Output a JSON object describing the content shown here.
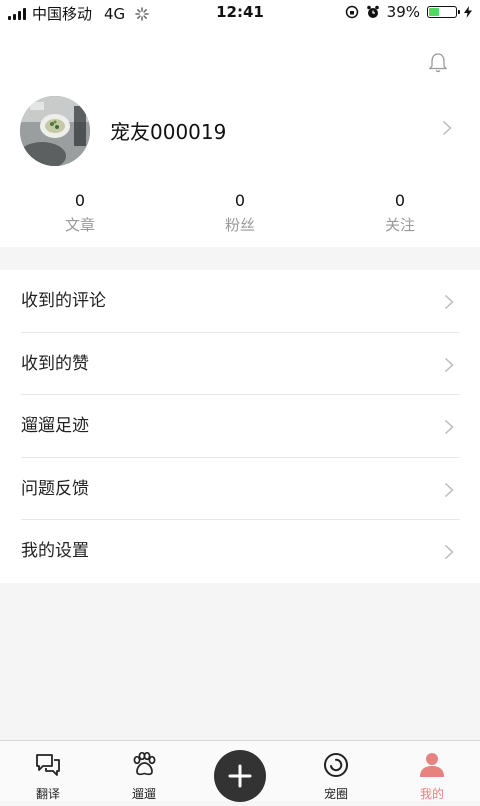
{
  "status_bar": {
    "carrier": "中国移动",
    "network": "4G",
    "time": "12:41",
    "battery_percent": "39%",
    "battery_level": 0.39
  },
  "profile": {
    "username": "宠友000019",
    "stats": [
      {
        "value": "0",
        "label": "文章"
      },
      {
        "value": "0",
        "label": "粉丝"
      },
      {
        "value": "0",
        "label": "关注"
      }
    ]
  },
  "menu": [
    {
      "label": "收到的评论"
    },
    {
      "label": "收到的赞"
    },
    {
      "label": "遛遛足迹"
    },
    {
      "label": "问题反馈"
    },
    {
      "label": "我的设置"
    }
  ],
  "tabbar": {
    "items": [
      {
        "label": "翻译",
        "icon": "chat-bubbles-icon"
      },
      {
        "label": "遛遛",
        "icon": "paw-icon"
      },
      {
        "label": "",
        "icon": "plus-icon"
      },
      {
        "label": "宠圈",
        "icon": "circle-icon"
      },
      {
        "label": "我的",
        "icon": "person-icon"
      }
    ],
    "active_color": "#e8827e"
  }
}
